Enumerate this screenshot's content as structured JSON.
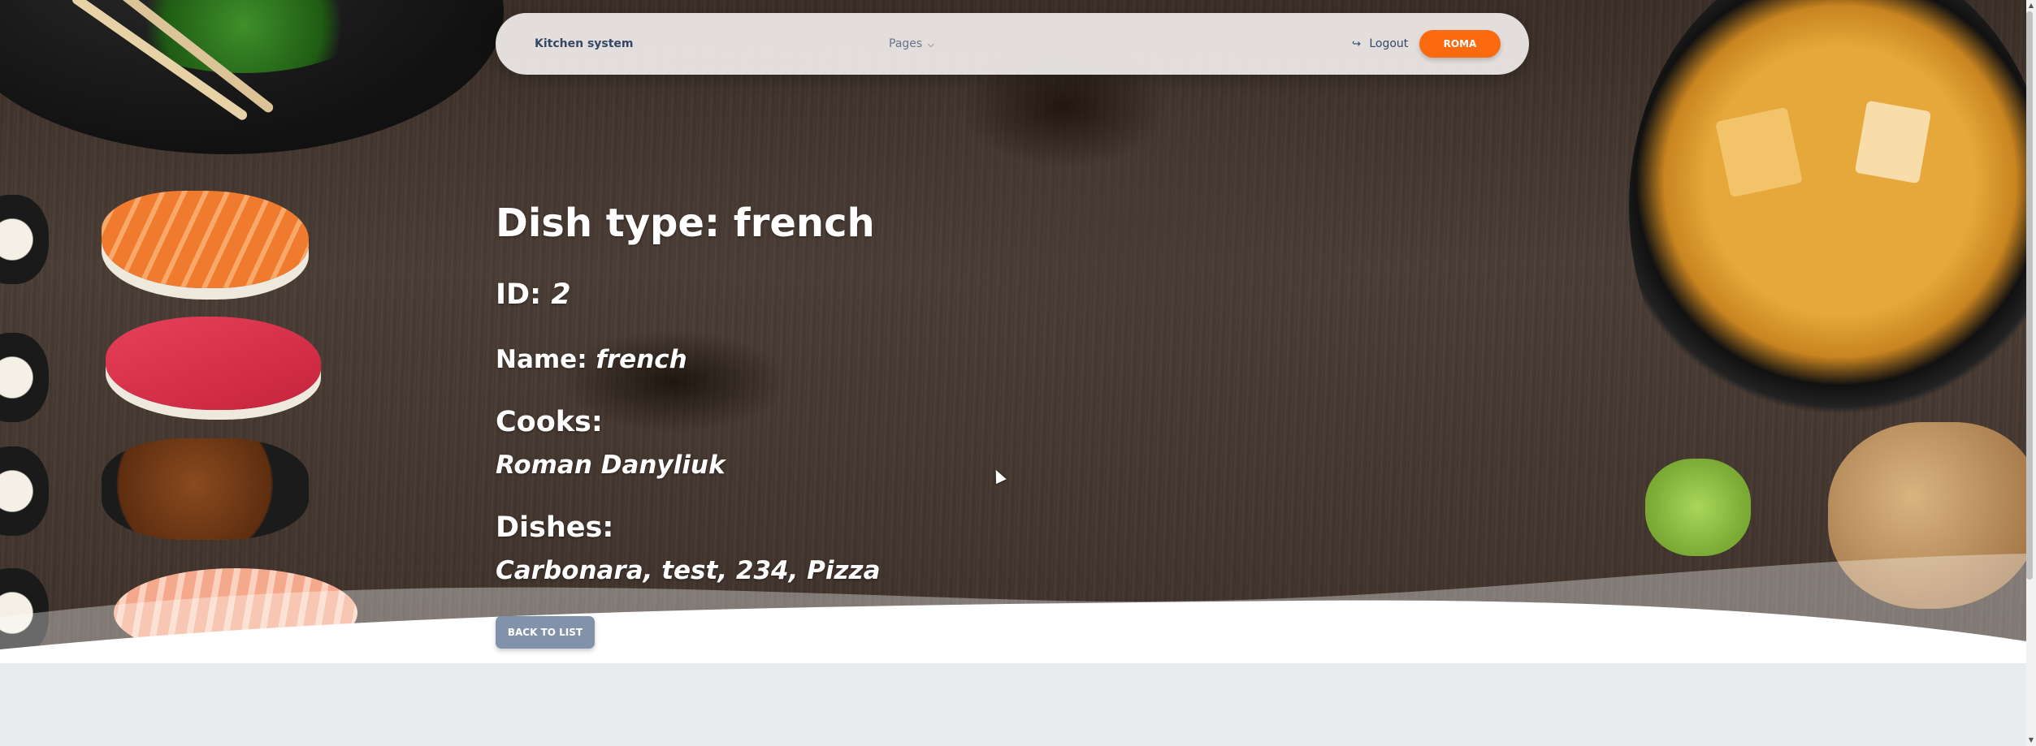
{
  "navbar": {
    "brand": "Kitchen system",
    "pages_label": "Pages",
    "logout_label": "Logout",
    "user_label": "ROMA"
  },
  "detail": {
    "title": "Dish type: french",
    "id_label": "ID: ",
    "id_value": "2",
    "name_label": "Name: ",
    "name_value": "french",
    "cooks_label": "Cooks:",
    "cooks_value": "Roman Danyliuk",
    "dishes_label": "Dishes:",
    "dishes_value": "Carbonara, test, 234, Pizza"
  },
  "actions": {
    "back_label": "BACK TO LIST"
  },
  "icons": {
    "logout": "logout-icon",
    "pages_dropdown": "chevron-down-icon"
  },
  "colors": {
    "accent": "#fb6a0f",
    "secondary": "#8392ab",
    "page_bg": "#e9ecef"
  }
}
